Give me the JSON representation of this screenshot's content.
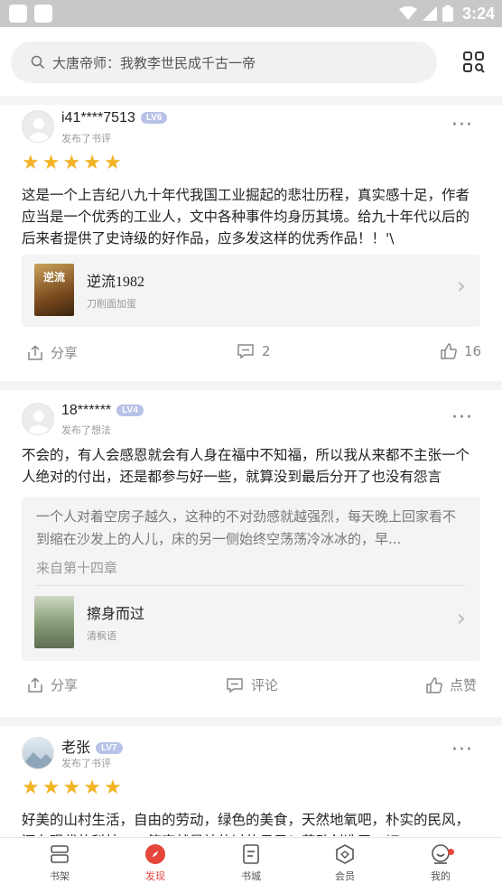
{
  "status_bar": {
    "time": "3:24"
  },
  "search": {
    "placeholder": "大唐帝师：我教李世民成千古一帝"
  },
  "posts": [
    {
      "username": "i41****7513",
      "level": "LV6",
      "action": "发布了书评",
      "rating": 5,
      "text": "这是一个上吉纪八九十年代我国工业掘起的悲壮历程，真实感十足，作者应当是一个优秀的工业人，文中各种事件均身历其境。给九十年代以后的后来者提供了史诗级的好作品，应多发这样的优秀作品！！'\\",
      "book": {
        "title": "逆流1982",
        "author": "刀削面加蛋",
        "cover_text": "逆流"
      },
      "share_label": "分享",
      "comment_count": "2",
      "like_count": "16"
    },
    {
      "username": "18******",
      "level": "LV4",
      "action": "发布了想法",
      "text": "不会的，有人会感恩就会有人身在福中不知福，所以我从来都不主张一个人绝对的付出，还是都参与好一些，就算没到最后分开了也没有怨言",
      "quote": "一个人对着空房子越久，这种的不对劲感就越强烈，每天晚上回家看不到缩在沙发上的人儿，床的另一侧始终空荡荡冷冰冰的，早...",
      "quote_source": "来自第十四章",
      "book": {
        "title": "擦身而过",
        "author": "清枫语"
      },
      "share_label": "分享",
      "comment_label": "评论",
      "like_label": "点赞"
    },
    {
      "username": "老张",
      "level": "LV7",
      "action": "发布了书评",
      "rating": 5,
      "text": "好美的山村生活，自由的劳动，绿色的美食，天然地氧吧，朴实的民风，还有现代的科技……简直就是神仙过的日子！劳动创造了一切"
    }
  ],
  "nav": {
    "items": [
      {
        "label": "书架"
      },
      {
        "label": "发现"
      },
      {
        "label": "书城"
      },
      {
        "label": "会员"
      },
      {
        "label": "我的"
      }
    ],
    "active_index": 1
  },
  "colors": {
    "accent": "#e4463a",
    "star": "#f2b324"
  }
}
